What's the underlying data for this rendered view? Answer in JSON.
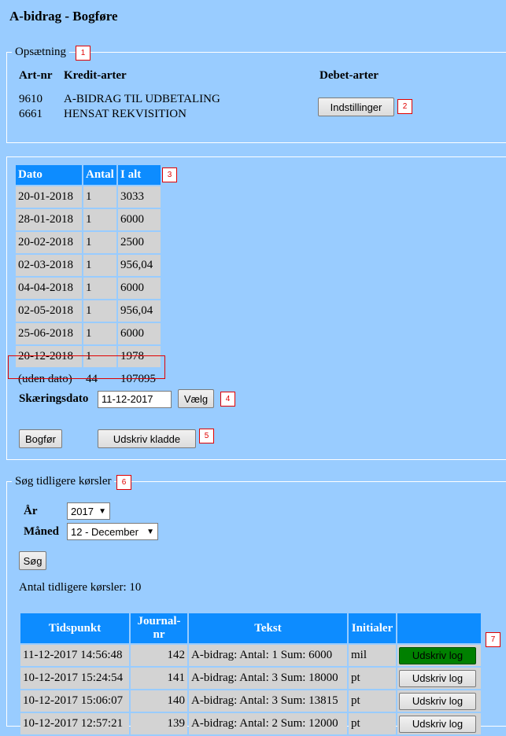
{
  "page": {
    "title": "A-bidrag - Bogføre"
  },
  "setup": {
    "legend": "Opsætning",
    "marker": "1",
    "col_artnr": "Art-nr",
    "col_kredit": "Kredit-arter",
    "col_debet": "Debet-arter",
    "rows": [
      {
        "artnr": "9610",
        "name": "A-BIDRAG TIL UDBETALING"
      },
      {
        "artnr": "6661",
        "name": "HENSAT REKVISITION"
      }
    ],
    "settings_button": "Indstillinger",
    "settings_marker": "2"
  },
  "summary": {
    "marker": "3",
    "headers": [
      "Dato",
      "Antal",
      "I alt"
    ],
    "rows": [
      {
        "dato": "20-01-2018",
        "antal": "1",
        "ialt": "3033"
      },
      {
        "dato": "28-01-2018",
        "antal": "1",
        "ialt": "6000"
      },
      {
        "dato": "20-02-2018",
        "antal": "1",
        "ialt": "2500"
      },
      {
        "dato": "02-03-2018",
        "antal": "1",
        "ialt": "956,04"
      },
      {
        "dato": "04-04-2018",
        "antal": "1",
        "ialt": "6000"
      },
      {
        "dato": "02-05-2018",
        "antal": "1",
        "ialt": "956,04"
      },
      {
        "dato": "25-06-2018",
        "antal": "1",
        "ialt": "6000"
      },
      {
        "dato": "20-12-2018",
        "antal": "1",
        "ialt": "1978"
      },
      {
        "dato": "(uden dato)",
        "antal": "44",
        "ialt": "107095"
      }
    ],
    "cutoff_label": "Skæringsdato",
    "cutoff_value": "11-12-2017",
    "choose_button": "Vælg",
    "choose_marker": "4",
    "post_button": "Bogfør",
    "print_button": "Udskriv kladde",
    "print_marker": "5"
  },
  "search": {
    "legend": "Søg tidligere kørsler",
    "marker": "6",
    "year_label": "År",
    "year_value": "2017",
    "month_label": "Måned",
    "month_value": "12 - December",
    "search_button": "Søg",
    "count_text": "Antal tidligere kørsler: 10",
    "headers": [
      "Tidspunkt",
      "Journal-nr",
      "Tekst",
      "Initialer",
      ""
    ],
    "log_button": "Udskriv log",
    "log_marker": "7",
    "runs": [
      {
        "time": "11-12-2017 14:56:48",
        "journal": "142",
        "text": "A-bidrag: Antal: 1 Sum: 6000",
        "initials": "mil"
      },
      {
        "time": "10-12-2017 15:24:54",
        "journal": "141",
        "text": "A-bidrag: Antal: 3 Sum: 18000",
        "initials": "pt"
      },
      {
        "time": "10-12-2017 15:06:07",
        "journal": "140",
        "text": "A-bidrag: Antal: 3 Sum: 13815",
        "initials": "pt"
      },
      {
        "time": "10-12-2017 12:57:21",
        "journal": "139",
        "text": "A-bidrag: Antal: 2 Sum: 12000",
        "initials": "pt"
      }
    ]
  }
}
